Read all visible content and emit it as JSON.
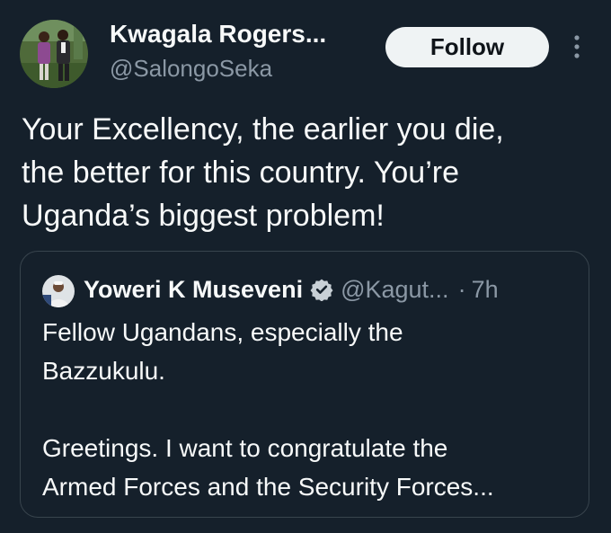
{
  "tweet": {
    "author_name": "Kwagala Rogers...",
    "author_handle": "@SalongoSeka",
    "follow_label": "Follow",
    "more_icon": "more-vertical-icon",
    "text_lines": [
      "Your Excellency, the earlier you die,",
      "the better for this country. You’re",
      "Uganda’s biggest problem!"
    ]
  },
  "quote": {
    "author_name": "Yoweri K Museveni",
    "verified_icon": "verified-badge-icon",
    "author_handle": "@Kagut...",
    "separator": "·",
    "time": "7h",
    "paragraph1_lines": [
      "Fellow Ugandans, especially the",
      "Bazzukulu."
    ],
    "paragraph2_lines": [
      "Greetings. I want to congratulate the",
      "Armed Forces and the Security Forces..."
    ]
  },
  "colors": {
    "background": "#15202b",
    "text_primary": "#f7f9f9",
    "text_secondary": "#8b98a5",
    "border": "#38444d",
    "follow_bg": "#eff3f4",
    "verified_badge": "#c8d0d6"
  }
}
